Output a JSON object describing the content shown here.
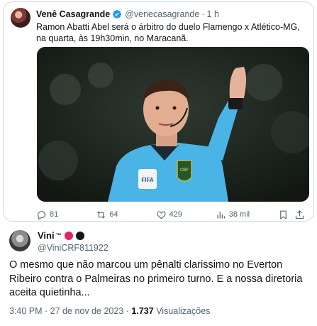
{
  "quoted_tweet": {
    "author_name": "Venê Casagrande",
    "author_handle": "@venecasagrande",
    "separator": "·",
    "time_ago": "1 h",
    "text": "Ramon Abatti Abel será o árbitro do duelo Flamengo x Atlético-MG, na quarta, às 19h30min, no Maracanã.",
    "media": {
      "badge_fifa": "FIFA",
      "badge_cbf": "CBF"
    },
    "actions": {
      "replies": "81",
      "retweets": "64",
      "likes": "429",
      "views": "38 mil"
    },
    "colors": {
      "verified": "#1d9bf0",
      "muted": "#536471"
    }
  },
  "reply": {
    "author_name": "Vini",
    "author_name_suffix": "™",
    "author_handle": "@ViniCRF811922",
    "text": "O mesmo que não marcou um pênalti clarissimo no Everton Ribeiro contra o Palmeiras no primeiro turno. E a nossa diretoria aceita quietinha...",
    "time": "3:40 PM",
    "date_separator": "·",
    "date": "27 de nov de 2023",
    "views_count": "1.737",
    "views_label": "Visualizações",
    "emoji_colors": [
      "#e0245e",
      "#14171a"
    ]
  }
}
